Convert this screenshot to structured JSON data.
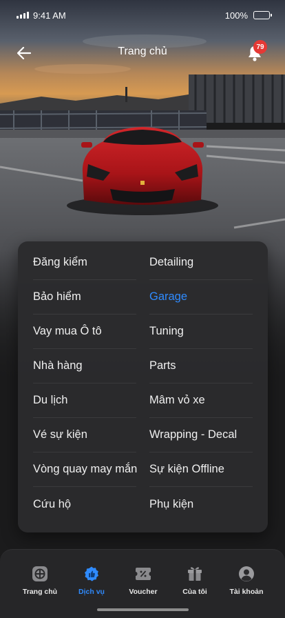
{
  "status_bar": {
    "time": "9:41 AM",
    "battery": "100%"
  },
  "header": {
    "title": "Trang chủ",
    "notification_count": "79"
  },
  "menu": {
    "left": [
      "Đăng kiểm",
      "Bảo hiểm",
      "Vay mua Ô tô",
      "Nhà hàng",
      "Du lịch",
      "Vé sự kiện",
      "Vòng quay may mắn",
      "Cứu hộ"
    ],
    "right": [
      "Detailing",
      "Garage",
      "Tuning",
      "Parts",
      "Mâm vỏ xe",
      "Wrapping - Decal",
      "Sự kiện Offline",
      "Phụ kiện"
    ],
    "active": "Garage"
  },
  "bottom_nav": {
    "items": [
      {
        "label": "Trang chủ",
        "icon": "home-grid-icon"
      },
      {
        "label": "Dịch vụ",
        "icon": "thumbs-up-icon"
      },
      {
        "label": "Voucher",
        "icon": "voucher-icon"
      },
      {
        "label": "Của tôi",
        "icon": "gift-icon"
      },
      {
        "label": "Tài khoản",
        "icon": "user-icon"
      }
    ],
    "active": "Dịch vụ"
  },
  "colors": {
    "accent": "#2f8bff",
    "badge": "#e53935",
    "background": "#1b1b1c",
    "card": "#2b2b2d"
  }
}
